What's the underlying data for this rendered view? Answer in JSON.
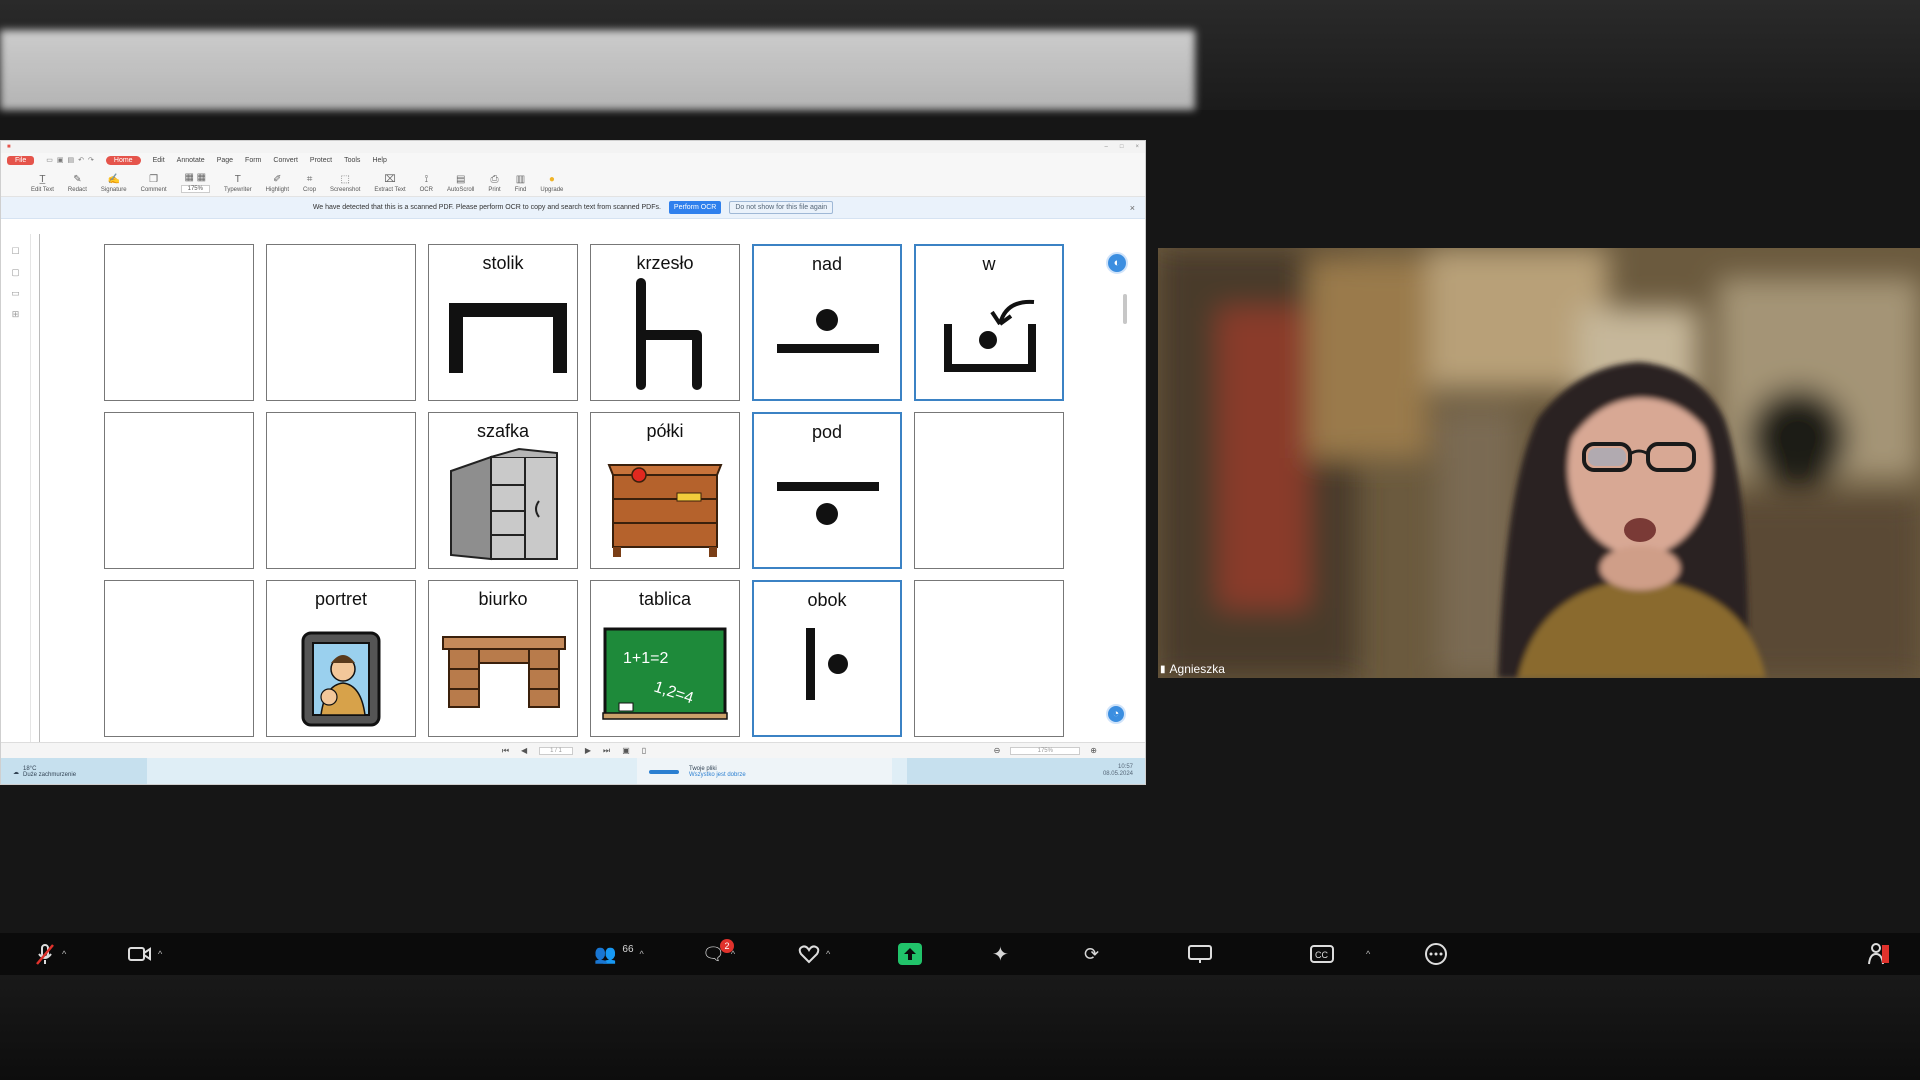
{
  "ocr_bar": {
    "message": "We have detected that this is a scanned PDF. Please perform OCR to copy and search text from scanned PDFs.",
    "perform_label": "Perform OCR",
    "dont_show_label": "Do not show for this file again"
  },
  "menu": {
    "file": "File",
    "tabs": [
      "Home",
      "Edit",
      "Annotate",
      "Page",
      "Form",
      "Convert",
      "Protect",
      "Tools",
      "Help"
    ]
  },
  "ribbon": {
    "zoom_value": "175%",
    "tools": [
      "Edit Text",
      "Redact",
      "Signature",
      "Comment",
      "Typewriter",
      "Highlight",
      "Crop",
      "Screenshot",
      "Extract Text",
      "OCR",
      "AutoScroll",
      "Print",
      "Find",
      "Upgrade"
    ]
  },
  "grid": {
    "cells": [
      {
        "label": ""
      },
      {
        "label": ""
      },
      {
        "label": "stolik",
        "icon": "table-symbol"
      },
      {
        "label": "krzesło",
        "icon": "chair-symbol"
      },
      {
        "label": "nad",
        "icon": "above-symbol"
      },
      {
        "label": "w",
        "icon": "in-symbol"
      },
      {
        "label": ""
      },
      {
        "label": ""
      },
      {
        "label": "szafka",
        "icon": "cabinet-picture"
      },
      {
        "label": "półki",
        "icon": "shelves-picture"
      },
      {
        "label": "pod",
        "icon": "below-symbol"
      },
      {
        "label": ""
      },
      {
        "label": ""
      },
      {
        "label": "portret",
        "icon": "portrait-picture"
      },
      {
        "label": "biurko",
        "icon": "desk-picture"
      },
      {
        "label": "tablica",
        "icon": "blackboard-picture",
        "board_text_1": "1+1=2",
        "board_text_2": "1,2=4"
      },
      {
        "label": "obok",
        "icon": "beside-symbol"
      },
      {
        "label": ""
      }
    ]
  },
  "statusbar": {
    "page_value": "1 / 1",
    "zoom_value": "175%"
  },
  "taskbar": {
    "weather_temp": "18°C",
    "weather_desc": "Duże zachmurzenie",
    "notif_title": "Twoje pliki",
    "notif_sub": "Wszystko jest dobrze",
    "time": "10:57",
    "date": "08.05.2024"
  },
  "participant": {
    "name": "Agnieszka"
  },
  "toolbar": {
    "participants_count": "66",
    "chat_badge": "2"
  },
  "colors": {
    "accent_red": "#e5544b",
    "share_green": "#21c36a",
    "cell_blue": "#3b82c4"
  }
}
